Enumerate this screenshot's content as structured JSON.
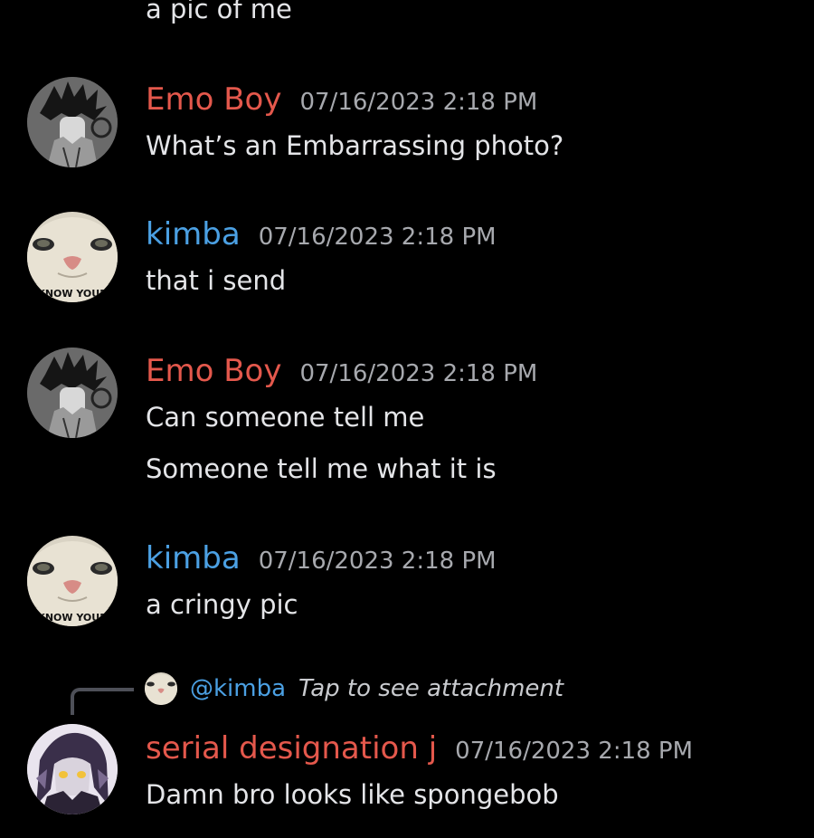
{
  "messages": {
    "top_fragment": "a pic of me",
    "m1": {
      "author": "Emo Boy",
      "timestamp": "07/16/2023 2:18 PM",
      "lines": [
        "What’s an Embarrassing photo?"
      ]
    },
    "m2": {
      "author": "kimba",
      "timestamp": "07/16/2023 2:18 PM",
      "lines": [
        "that i send"
      ],
      "avatar_caption": "KNOW YOUR"
    },
    "m3": {
      "author": "Emo Boy",
      "timestamp": "07/16/2023 2:18 PM",
      "lines": [
        "Can someone tell me",
        "Someone tell me what it is"
      ]
    },
    "m4": {
      "author": "kimba",
      "timestamp": "07/16/2023 2:18 PM",
      "lines": [
        "a cringy pic"
      ],
      "avatar_caption": "KNOW YOUR"
    },
    "m5": {
      "reply": {
        "mention": "@kimba",
        "text": "Tap to see attachment"
      },
      "author": "serial designation j",
      "timestamp": "07/16/2023 2:18 PM",
      "lines": [
        "Damn bro looks like spongebob"
      ]
    }
  },
  "colors": {
    "background": "#000000",
    "emo_author": "#e4584c",
    "kimba_author": "#4ba0e3",
    "serial_author": "#e4584c",
    "timestamp": "#a7a9ae",
    "text": "#e4e5e8"
  },
  "icons": {
    "emo_avatar": "anime-boy-avatar-icon",
    "kimba_avatar": "cat-face-avatar-icon",
    "serial_avatar": "anime-girl-avatar-icon"
  }
}
